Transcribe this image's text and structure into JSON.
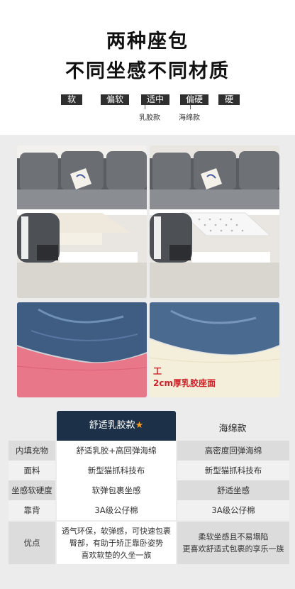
{
  "header": {
    "title_line1": "两种座包",
    "title_line2": "不同坐感不同材质"
  },
  "softness_scale": {
    "levels": [
      "软",
      "偏软",
      "适中",
      "偏硬",
      "硬"
    ],
    "notes": [
      "乳胶款",
      "海绵款"
    ]
  },
  "gallery": {
    "latex_caption": "2cm厚乳胶座面",
    "latex_caption_mark": "工"
  },
  "comparison": {
    "col_left": "舒适乳胶款",
    "col_left_star": "★",
    "col_right": "海绵款",
    "rows": [
      {
        "label": "内填充物",
        "left": "舒适乳胶+高回弹海绵",
        "right": "高密度回弹海绵"
      },
      {
        "label": "面料",
        "left": "新型猫抓科技布",
        "right": "新型猫抓科技布"
      },
      {
        "label": "坐感软硬度",
        "left": "软弹包裹坐感",
        "right": "舒适坐感"
      },
      {
        "label": "靠背",
        "left": "3A级公仔棉",
        "right": "3A级公仔棉"
      },
      {
        "label": "优点",
        "left_lines": [
          "透气环保，软弹感，可快速包裹",
          "臀部，有助于矫正靠卧姿势",
          "喜欢软垫的久坐一族"
        ],
        "right_lines": [
          "柔软坐感且不易塌陷",
          "更喜欢舒适式包裹的享乐一族"
        ]
      }
    ]
  },
  "colors": {
    "header_dark": "#1c3148",
    "scale_dark": "#2f2f2f",
    "star": "#f0a020",
    "caption_red": "#d0202a"
  }
}
